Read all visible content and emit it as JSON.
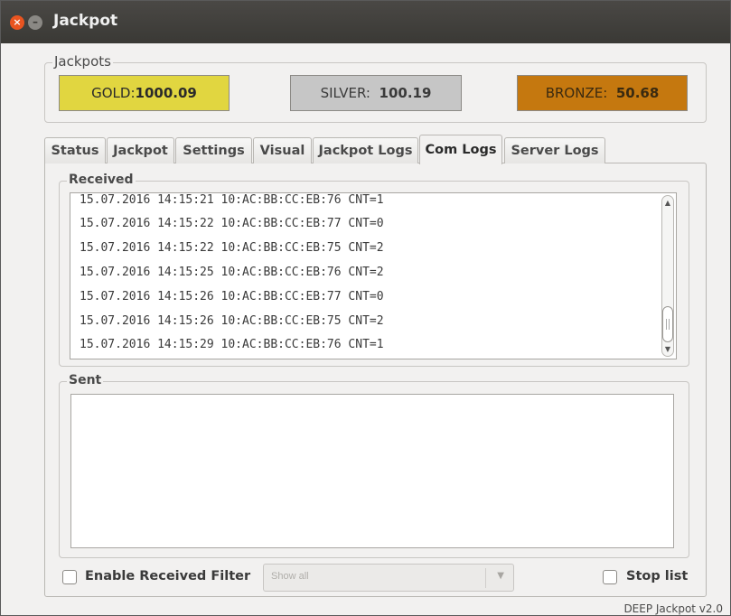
{
  "window": {
    "title": "Jackpot"
  },
  "jackpots": {
    "label": "Jackpots",
    "gold": {
      "name": "GOLD:",
      "value": "1000.09"
    },
    "silver": {
      "name": "SILVER:",
      "value": "100.19"
    },
    "bronze": {
      "name": "BRONZE:",
      "value": "50.68"
    }
  },
  "tabs": [
    "Status",
    "Jackpot",
    "Settings",
    "Visual",
    "Jackpot Logs",
    "Com Logs",
    "Server Logs"
  ],
  "active_tab": "Com Logs",
  "received": {
    "label": "Received",
    "lines": [
      "15.07.2016 14:15:21 10:AC:BB:CC:EB:76 CNT=1",
      "15.07.2016 14:15:22 10:AC:BB:CC:EB:77 CNT=0",
      "15.07.2016 14:15:22 10:AC:BB:CC:EB:75 CNT=2",
      "15.07.2016 14:15:25 10:AC:BB:CC:EB:76 CNT=2",
      "15.07.2016 14:15:26 10:AC:BB:CC:EB:77 CNT=0",
      "15.07.2016 14:15:26 10:AC:BB:CC:EB:75 CNT=2",
      "15.07.2016 14:15:29 10:AC:BB:CC:EB:76 CNT=1"
    ]
  },
  "sent": {
    "label": "Sent"
  },
  "filter": {
    "enable_label": "Enable Received Filter",
    "enabled": false,
    "select_value": "Show all",
    "stop_label": "Stop list",
    "stopped": false
  },
  "footer": {
    "version": "DEEP Jackpot v2.0"
  },
  "colors": {
    "gold": "#e1d640",
    "silver": "#c6c6c6",
    "bronze": "#c5780f",
    "close_button": "#e95420"
  }
}
